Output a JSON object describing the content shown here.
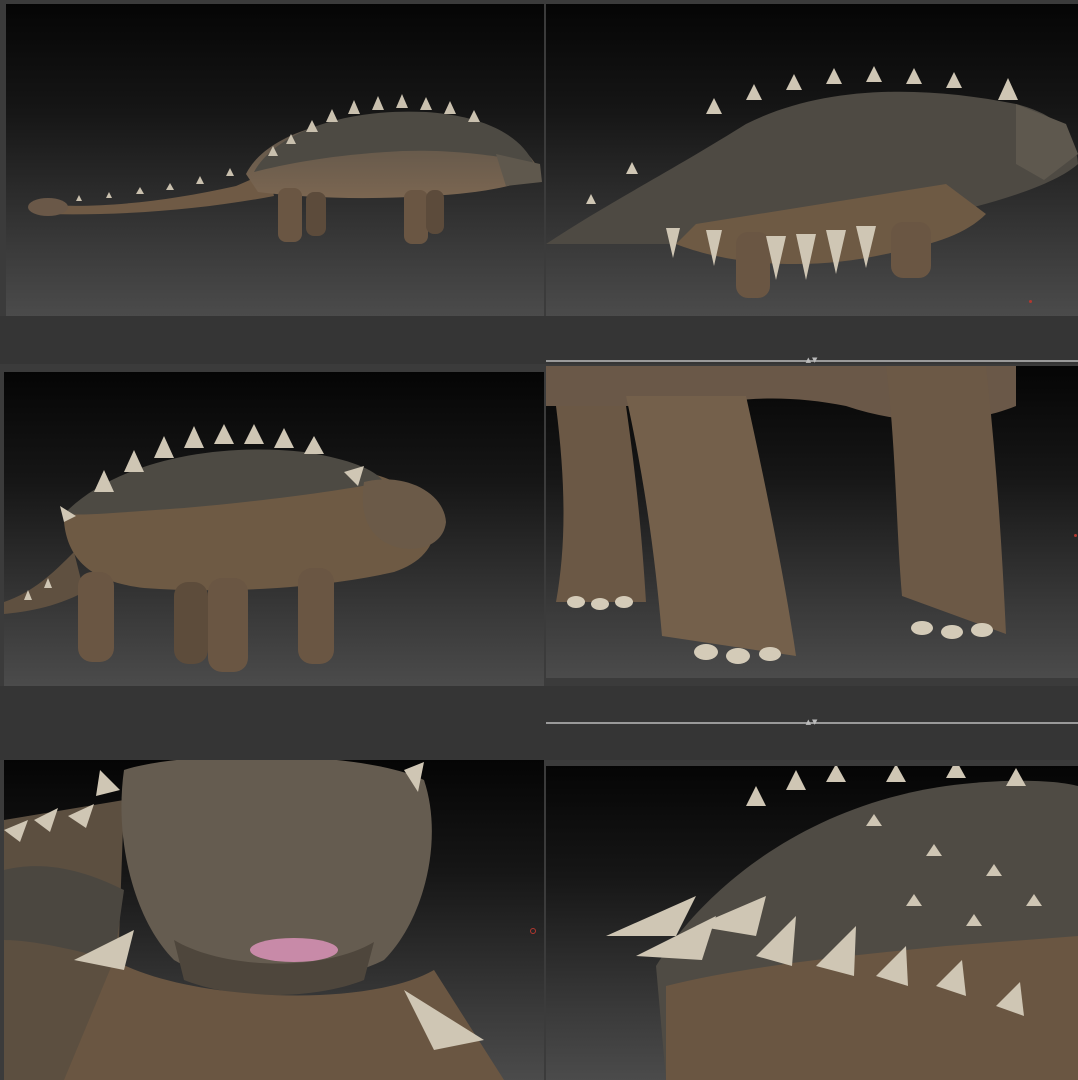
{
  "sheet": {
    "panels": [
      {
        "name": "full-side-view",
        "subject": "ankylosaur-model"
      },
      {
        "name": "rear-quarter-view",
        "subject": "ankylosaur-model"
      },
      {
        "name": "front-quarter-view",
        "subject": "ankylosaur-model"
      },
      {
        "name": "feet-closeup",
        "subject": "ankylosaur-legs"
      },
      {
        "name": "head-closeup",
        "subject": "ankylosaur-head"
      },
      {
        "name": "armor-closeup",
        "subject": "ankylosaur-armor"
      }
    ]
  },
  "colors": {
    "background": "#3b3b3b",
    "viewport_top": "#050505",
    "viewport_bottom": "#4b4b4b",
    "skin": "#6e5a44",
    "armor": "#4a4a44",
    "spike": "#cfc6b4",
    "tongue": "#c88aa8",
    "marker": "#b3372f"
  },
  "icons": {
    "divider_handle": "drag-handle-icon",
    "marker": "transform-pivot-icon"
  },
  "divider_handle_glyph": "▲▼"
}
